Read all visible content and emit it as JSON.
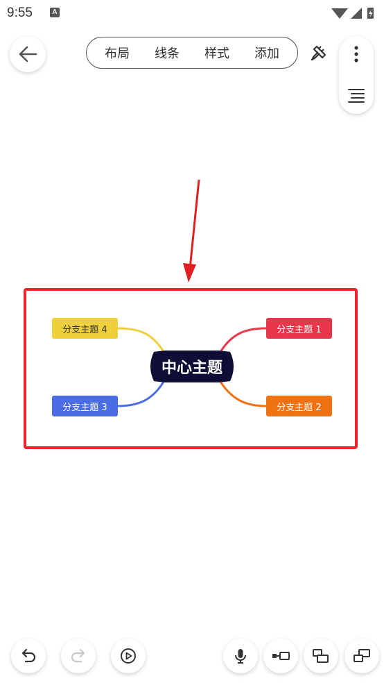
{
  "status_bar": {
    "time": "9:55",
    "notification_letter": "A"
  },
  "toolbar": {
    "tabs": [
      {
        "label": "布局"
      },
      {
        "label": "线条"
      },
      {
        "label": "样式"
      },
      {
        "label": "添加"
      }
    ]
  },
  "icons": {
    "back": "arrow-left-icon",
    "brush": "paint-brush-icon",
    "more": "more-vertical-icon",
    "outline": "list-outline-icon",
    "undo": "undo-icon",
    "redo": "redo-icon",
    "play": "play-circle-icon",
    "mic": "microphone-icon",
    "add_child": "add-child-node-icon",
    "add_sibling": "add-sibling-node-icon",
    "add_parent": "add-parent-node-icon"
  },
  "mindmap": {
    "central_topic": "中心主题",
    "branches": [
      {
        "label": "分支主题 1",
        "color": "#e8364a"
      },
      {
        "label": "分支主题 2",
        "color": "#f07212"
      },
      {
        "label": "分支主题 3",
        "color": "#4a6de5"
      },
      {
        "label": "分支主题 4",
        "color": "#efcf3b"
      }
    ]
  },
  "annotation": {
    "arrow_color": "#e02020",
    "box_color": "#f0252a"
  }
}
